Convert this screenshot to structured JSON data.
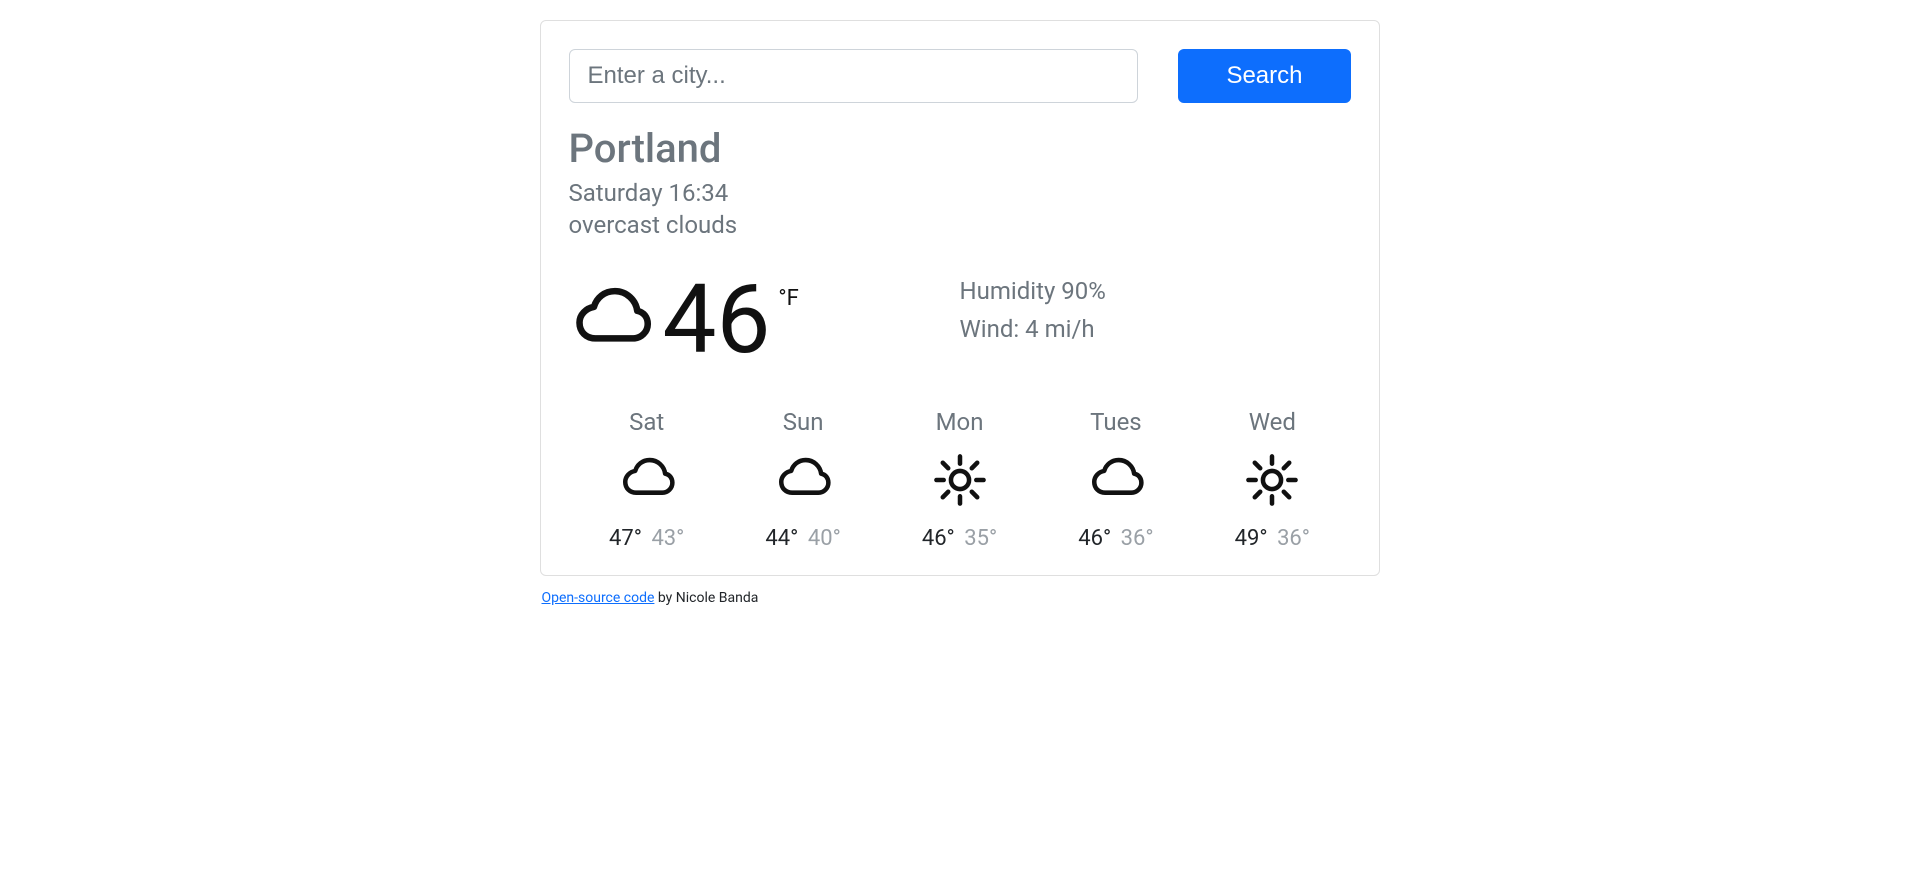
{
  "search": {
    "placeholder": "Enter a city...",
    "button_label": "Search"
  },
  "current": {
    "city": "Portland",
    "datetime": "Saturday 16:34",
    "description": "overcast clouds",
    "temperature": "46",
    "unit": "°F",
    "humidity": "Humidity 90%",
    "wind": "Wind: 4 mi/h",
    "icon": "cloud"
  },
  "forecast": [
    {
      "day": "Sat",
      "icon": "cloud",
      "hi": "47°",
      "lo": "43°"
    },
    {
      "day": "Sun",
      "icon": "cloud",
      "hi": "44°",
      "lo": "40°"
    },
    {
      "day": "Mon",
      "icon": "sun",
      "hi": "46°",
      "lo": "35°"
    },
    {
      "day": "Tues",
      "icon": "cloud",
      "hi": "46°",
      "lo": "36°"
    },
    {
      "day": "Wed",
      "icon": "sun",
      "hi": "49°",
      "lo": "36°"
    }
  ],
  "footer": {
    "link_text": "Open-source code",
    "suffix": " by Nicole Banda"
  }
}
